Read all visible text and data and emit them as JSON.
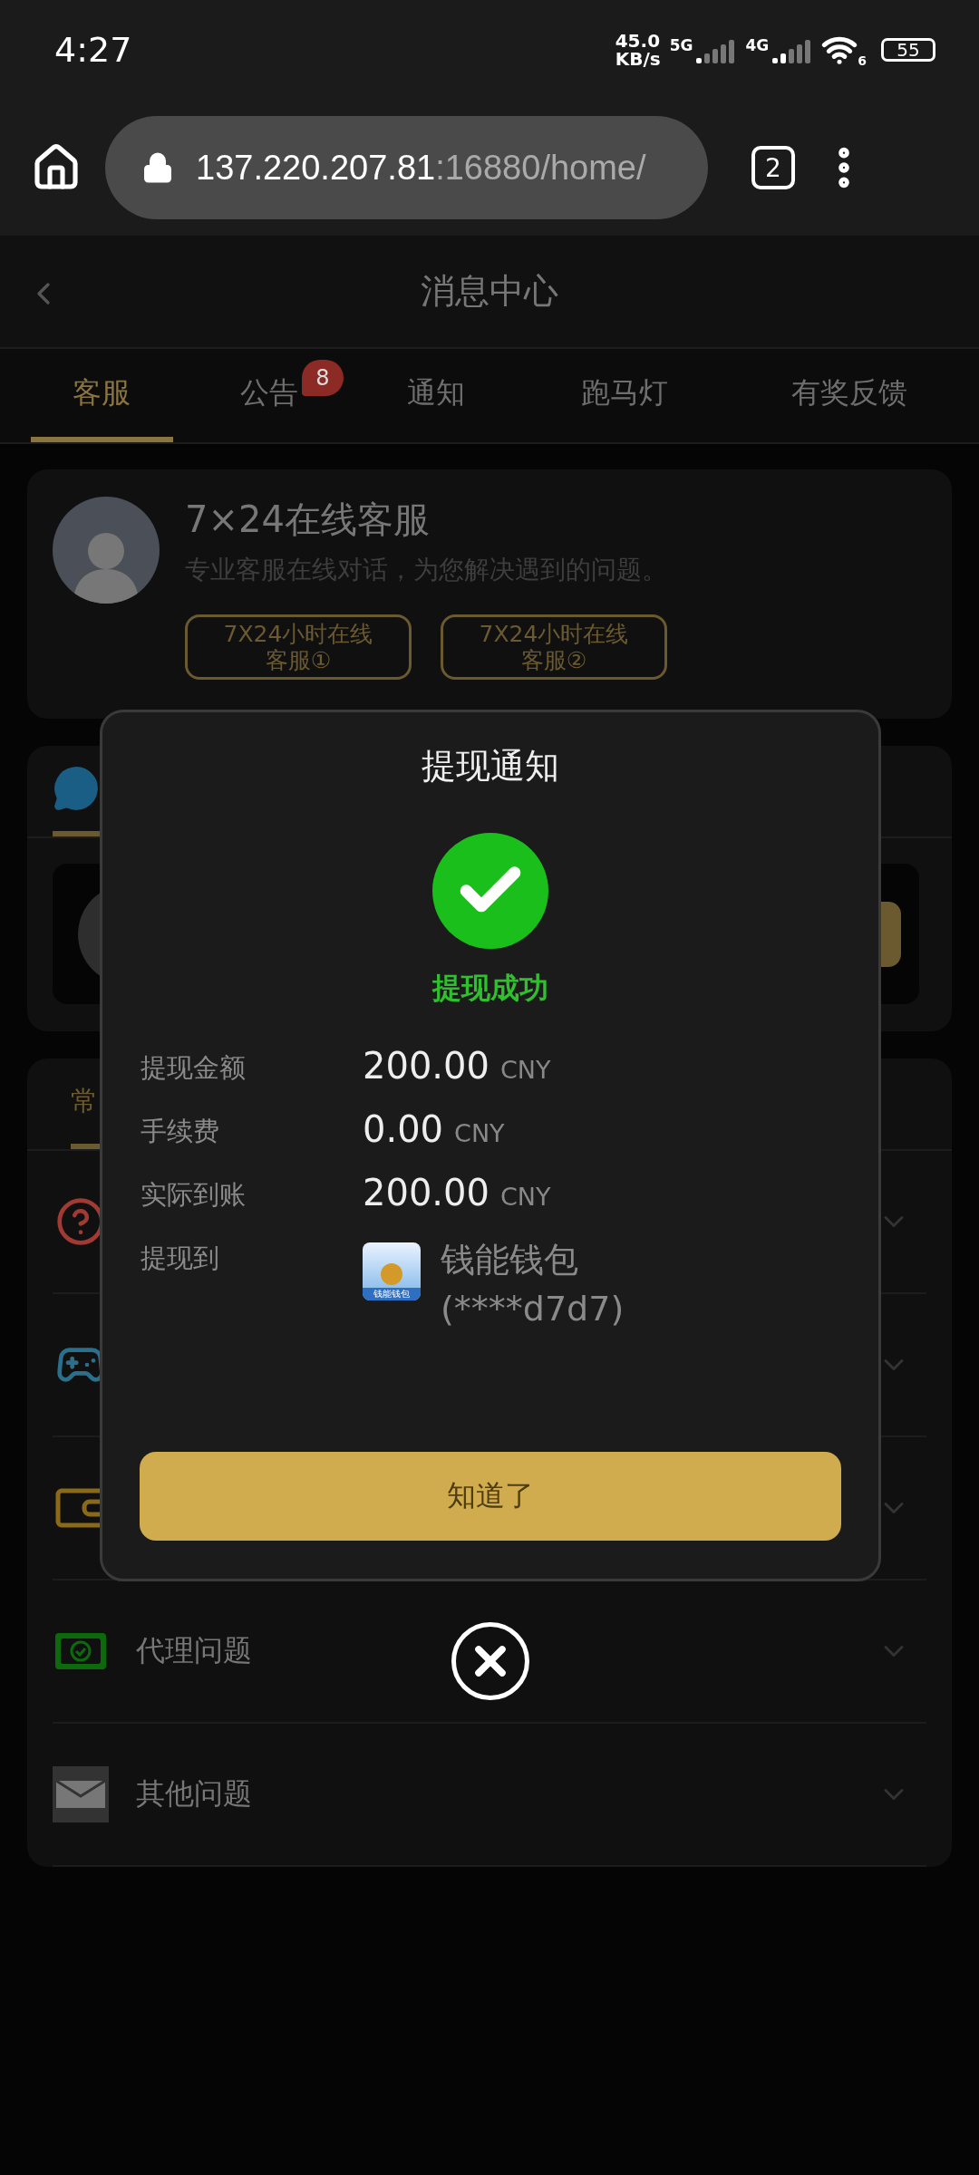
{
  "status_bar": {
    "time": "4:27",
    "speed": "45.0",
    "speed_unit": "KB/s",
    "network_1": "5G",
    "network_2": "4G",
    "wifi_label": "6",
    "battery": "55"
  },
  "browser": {
    "url_host": "137.220.207.81",
    "url_path": ":16880/home/",
    "tab_count": "2"
  },
  "header": {
    "title": "消息中心"
  },
  "tabs": [
    {
      "label": "客服",
      "selected": true
    },
    {
      "label": "公告",
      "selected": false,
      "badge": "8"
    },
    {
      "label": "通知",
      "selected": false
    },
    {
      "label": "跑马灯",
      "selected": false
    },
    {
      "label": "有奖反馈",
      "selected": false
    }
  ],
  "service_card": {
    "title": "7×24在线客服",
    "subtitle": "专业客服在线对话，为您解决遇到的问题。",
    "buttons": [
      [
        "7X24小时在线",
        "客服①"
      ],
      [
        "7X24小时在线",
        "客服②"
      ]
    ]
  },
  "faq": {
    "tabs": [
      {
        "label": "常",
        "selected": true
      }
    ],
    "rows": [
      {
        "kind": "help"
      },
      {
        "kind": "game"
      },
      {
        "kind": "wallet"
      },
      {
        "kind": "agent",
        "label": "代理问题"
      },
      {
        "kind": "mail",
        "label": "其他问题"
      }
    ]
  },
  "dialog": {
    "title": "提现通知",
    "status": "提现成功",
    "rows": [
      {
        "label": "提现金额",
        "value": "200.00",
        "unit": "CNY"
      },
      {
        "label": "手续费",
        "value": "0.00",
        "unit": "CNY"
      },
      {
        "label": "实际到账",
        "value": "200.00",
        "unit": "CNY"
      }
    ],
    "destination": {
      "label": "提现到",
      "name": "钱能钱包",
      "account": "(****d7d7)",
      "logo_text": "钱能钱包"
    },
    "confirm": "知道了"
  }
}
